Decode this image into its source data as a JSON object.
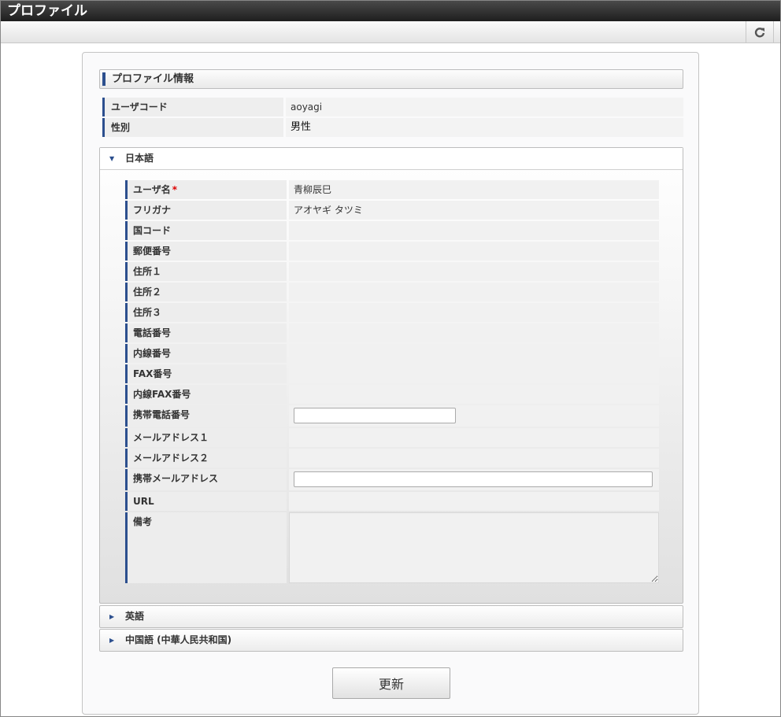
{
  "window": {
    "title": "プロファイル"
  },
  "toolbar": {
    "refresh_icon": "refresh-icon"
  },
  "profile": {
    "section_title": "プロファイル情報",
    "summary": [
      {
        "label": "ユーザコード",
        "value": "aoyagi"
      },
      {
        "label": "性別",
        "value": "男性"
      }
    ]
  },
  "languages": {
    "japanese": {
      "title": "日本語",
      "fields": [
        {
          "label": "ユーザ名",
          "required": "*",
          "value": "青柳辰巳"
        },
        {
          "label": "フリガナ",
          "value": "アオヤギ タツミ"
        },
        {
          "label": "国コード",
          "value": ""
        },
        {
          "label": "郵便番号",
          "value": ""
        },
        {
          "label": "住所１",
          "value": ""
        },
        {
          "label": "住所２",
          "value": ""
        },
        {
          "label": "住所３",
          "value": ""
        },
        {
          "label": "電話番号",
          "value": ""
        },
        {
          "label": "内線番号",
          "value": ""
        },
        {
          "label": "FAX番号",
          "value": ""
        },
        {
          "label": "内線FAX番号",
          "value": ""
        },
        {
          "label": "携帯電話番号",
          "input_value": ""
        },
        {
          "label": "メールアドレス１",
          "value": ""
        },
        {
          "label": "メールアドレス２",
          "value": ""
        },
        {
          "label": "携帯メールアドレス",
          "input_value": ""
        },
        {
          "label": "URL",
          "value": ""
        },
        {
          "label": "備考",
          "value": ""
        }
      ]
    },
    "english": {
      "title": "英語"
    },
    "chinese": {
      "title": "中国語 (中華人民共和国)"
    }
  },
  "actions": {
    "update_label": "更新"
  },
  "colors": {
    "accent": "#2c4f8e",
    "titlebar": "#2a2a2a",
    "required": "#dd0000"
  }
}
